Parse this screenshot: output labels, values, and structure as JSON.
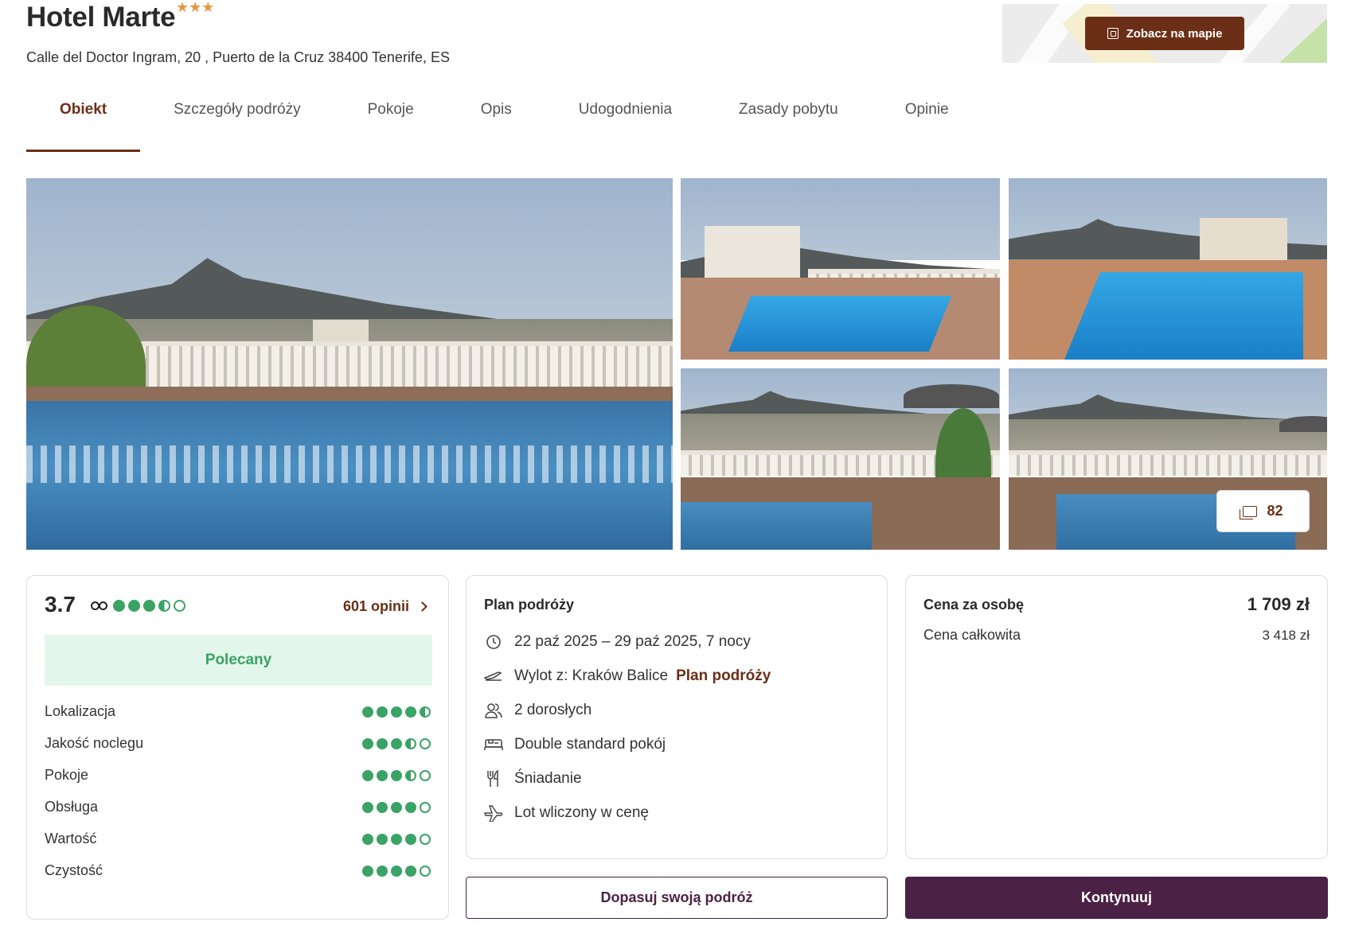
{
  "hotel": {
    "name": "Hotel Marte",
    "stars": "★★★",
    "address": "Calle del Doctor Ingram, 20 , Puerto de la Cruz 38400 Tenerife, ES",
    "map_button": "Zobacz na mapie"
  },
  "tabs": [
    {
      "label": "Obiekt",
      "active": true
    },
    {
      "label": "Szczegóły podróży"
    },
    {
      "label": "Pokoje"
    },
    {
      "label": "Opis"
    },
    {
      "label": "Udogodnienia"
    },
    {
      "label": "Zasady pobytu"
    },
    {
      "label": "Opinie"
    }
  ],
  "gallery": {
    "photo_count": "82"
  },
  "rating": {
    "score": "3.7",
    "score_dots": 3.5,
    "reviews_link": "601 opinii",
    "badge": "Polecany",
    "criteria": [
      {
        "label": "Lokalizacja",
        "value": 4.5
      },
      {
        "label": "Jakość noclegu",
        "value": 3.5
      },
      {
        "label": "Pokoje",
        "value": 3.5
      },
      {
        "label": "Obsługa",
        "value": 4
      },
      {
        "label": "Wartość",
        "value": 4
      },
      {
        "label": "Czystość",
        "value": 4
      }
    ]
  },
  "plan": {
    "title": "Plan podróży",
    "dates": "22 paź 2025 – 29 paź 2025, 7 nocy",
    "departure": "Wylot z: Kraków Balice",
    "departure_link": "Plan podróży",
    "guests": "2 dorosłych",
    "room": "Double standard pokój",
    "board": "Śniadanie",
    "flight": "Lot wliczony w cenę"
  },
  "price": {
    "per_person_label": "Cena za osobę",
    "per_person_value": "1 709 zł",
    "total_label": "Cena całkowita",
    "total_value": "3 418 zł"
  },
  "actions": {
    "customize": "Dopasuj swoją podróż",
    "continue": "Kontynuuj"
  },
  "colors": {
    "brand": "#6b2e16",
    "primary": "#4b2245",
    "rating_green": "#3aa365",
    "badge_bg": "#e3f6eb",
    "stars": "#e7963c"
  }
}
